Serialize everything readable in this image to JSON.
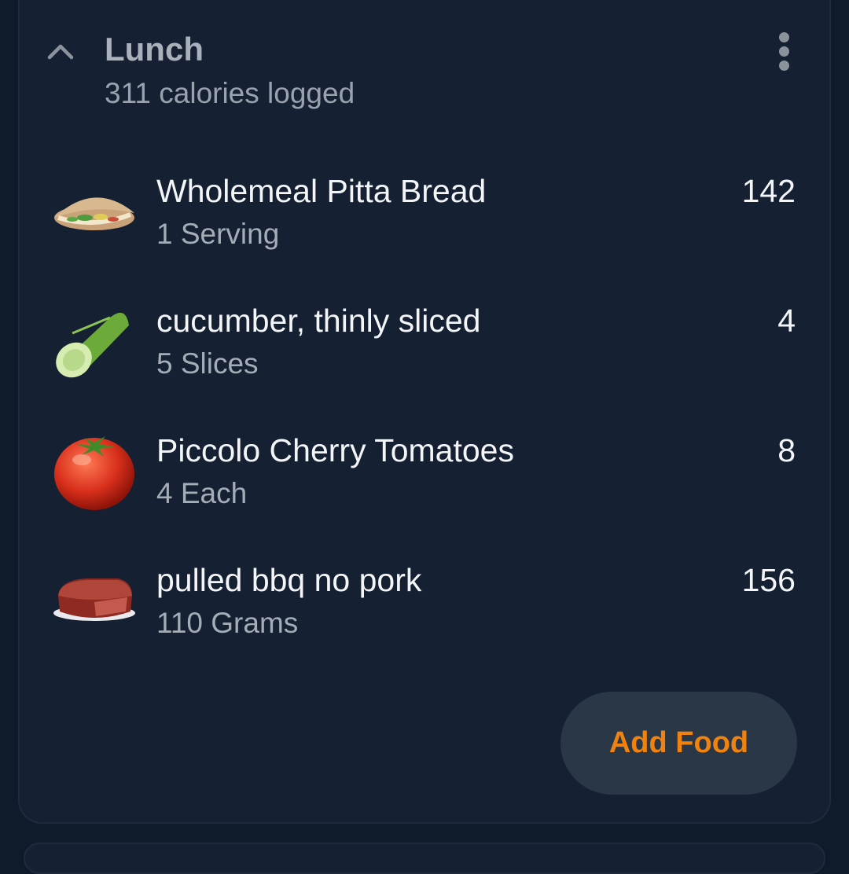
{
  "meal": {
    "title": "Lunch",
    "subtitle": "311 calories logged"
  },
  "foods": [
    {
      "name": "Wholemeal Pitta Bread",
      "quantity": "1 Serving",
      "calories": "142",
      "icon": "pitta-bread-icon"
    },
    {
      "name": "cucumber, thinly sliced",
      "quantity": "5 Slices",
      "calories": "4",
      "icon": "cucumber-icon"
    },
    {
      "name": "Piccolo Cherry Tomatoes",
      "quantity": "4 Each",
      "calories": "8",
      "icon": "tomato-icon"
    },
    {
      "name": "pulled bbq no pork",
      "quantity": "110 Grams",
      "calories": "156",
      "icon": "meat-icon"
    }
  ],
  "actions": {
    "add_food_label": "Add Food"
  },
  "colors": {
    "background": "#0f1b2a",
    "card": "#152133",
    "accent": "#f0820f",
    "button_bg": "#2a3746"
  }
}
